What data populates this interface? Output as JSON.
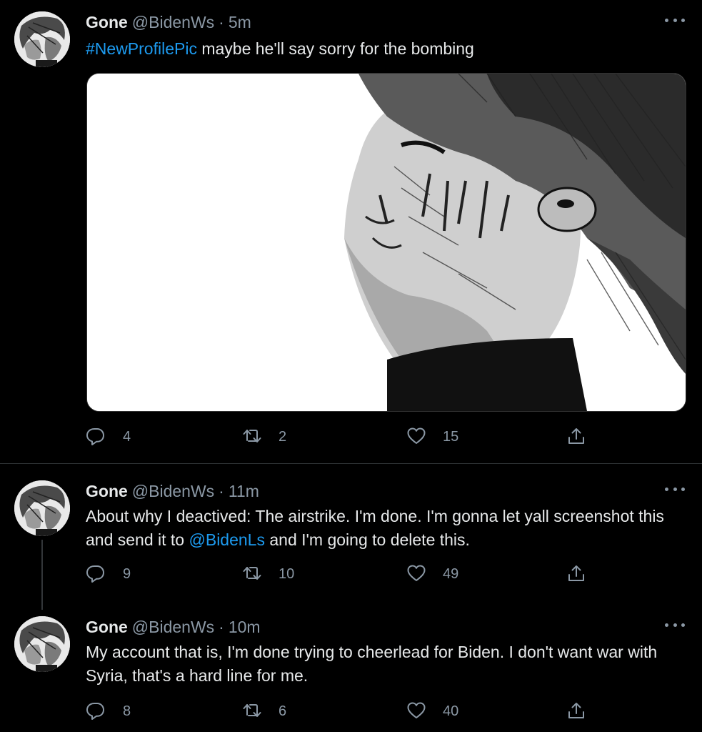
{
  "tweets": [
    {
      "name": "Gone",
      "handle": "@BidenWs",
      "dot": "·",
      "time": "5m",
      "text_link": "#NewProfilePic",
      "text_rest": " maybe he'll say sorry for the bombing",
      "replies": "4",
      "retweets": "2",
      "likes": "15"
    },
    {
      "name": "Gone",
      "handle": "@BidenWs",
      "dot": "·",
      "time": "11m",
      "text_a": "About why I deactived: The airstrike. I'm done. I'm gonna let yall screenshot this and send it to ",
      "text_link": "@BidenLs",
      "text_b": " and I'm going to delete this.",
      "replies": "9",
      "retweets": "10",
      "likes": "49"
    },
    {
      "name": "Gone",
      "handle": "@BidenWs",
      "dot": "·",
      "time": "10m",
      "text": "My account that is, I'm done trying to cheerlead for Biden. I don't want war with Syria, that's a hard line for me.",
      "replies": "8",
      "retweets": "6",
      "likes": "40"
    }
  ],
  "icons": {
    "reply": "reply-icon",
    "retweet": "retweet-icon",
    "like": "heart-icon",
    "share": "share-icon",
    "more": "more-icon"
  },
  "colors": {
    "background": "#000000",
    "text": "#e7e9ea",
    "secondary": "#8b98a5",
    "link": "#1d9bf0"
  }
}
